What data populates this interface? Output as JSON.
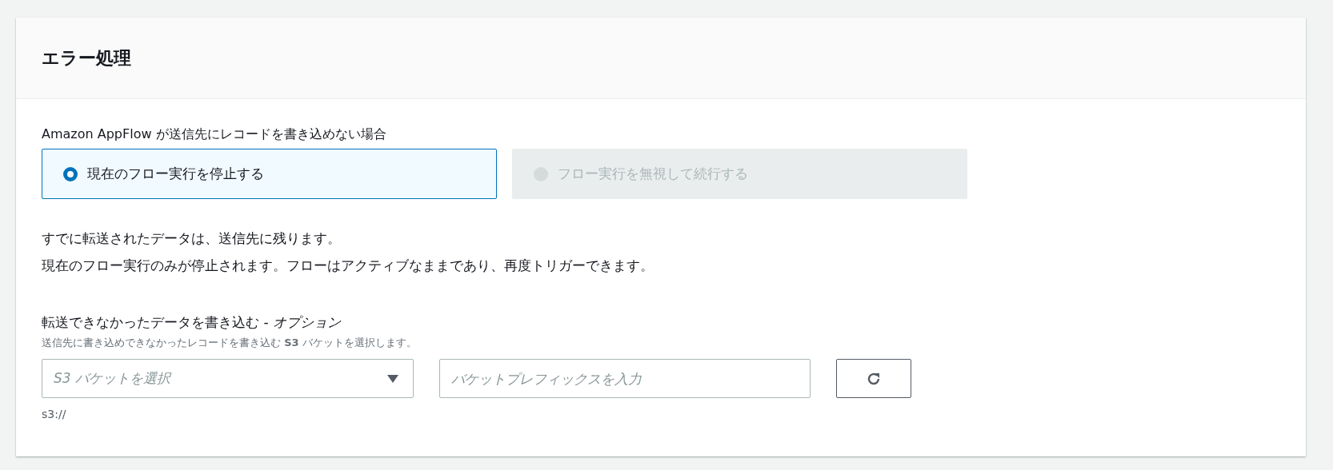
{
  "panel": {
    "title": "エラー処理"
  },
  "failure_option": {
    "label": "Amazon AppFlow が送信先にレコードを書き込めない場合",
    "options": [
      {
        "label": "現在のフロー実行を停止する",
        "selected": true,
        "disabled": false
      },
      {
        "label": "フロー実行を無視して続行する",
        "selected": false,
        "disabled": true
      }
    ]
  },
  "explanation": [
    "すでに転送されたデータは、送信先に残ります。",
    "現在のフロー実行のみが停止されます。フローはアクティブなままであり、再度トリガーできます。"
  ],
  "failed_data": {
    "label": "転送できなかったデータを書き込む - *オプション*",
    "description": "送信先に書き込めできなかったレコードを書き込む **S3** バケットを選択します。",
    "bucket_select": {
      "placeholder": "S3 バケットを選択"
    },
    "prefix_input": {
      "placeholder": "バケットプレフィックスを入力"
    },
    "hint": "s3://"
  }
}
